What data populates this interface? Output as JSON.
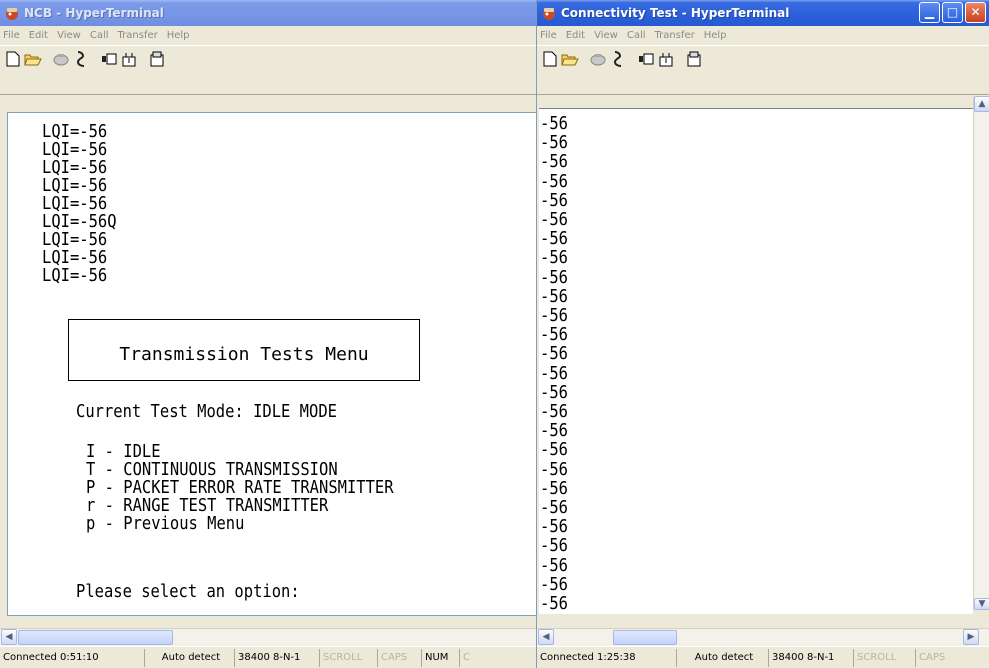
{
  "windows": {
    "left": {
      "title": "NCB - HyperTerminal",
      "menu": [
        "File",
        "Edit",
        "View",
        "Call",
        "Transfer",
        "Help"
      ],
      "terminal": {
        "lqi_lines": [
          "LQI=-56",
          "LQI=-56",
          "LQI=-56",
          "LQI=-56",
          "LQI=-56",
          "LQI=-56Q",
          "LQI=-56",
          "LQI=-56",
          "LQI=-56"
        ],
        "menu_title": "Transmission Tests Menu",
        "current_mode": "Current Test Mode: IDLE MODE",
        "options": [
          "I - IDLE",
          "T - CONTINUOUS TRANSMISSION",
          "P - PACKET ERROR RATE TRANSMITTER",
          "r - RANGE TEST TRANSMITTER",
          "p - Previous Menu"
        ],
        "prompt": "Please select an option:"
      },
      "status": {
        "connected": "Connected 0:51:10",
        "detect": "Auto detect",
        "settings": "38400 8-N-1",
        "scroll": "SCROLL",
        "caps": "CAPS",
        "num": "NUM",
        "extra": "C"
      }
    },
    "right": {
      "title": "Connectivity Test - HyperTerminal",
      "menu": [
        "File",
        "Edit",
        "View",
        "Call",
        "Transfer",
        "Help"
      ],
      "terminal": {
        "lines": [
          "-56",
          "-56",
          "-56",
          "-56",
          "-56",
          "-56",
          "-56",
          "-56",
          "-56",
          "-56",
          "-56",
          "-56",
          "-56",
          "-56",
          "-56",
          "-56",
          "-56",
          "-56",
          "-56",
          "-56",
          "-56",
          "-56",
          "-56",
          "-56",
          "-56",
          "-56"
        ]
      },
      "status": {
        "connected": "Connected 1:25:38",
        "detect": "Auto detect",
        "settings": "38400 8-N-1",
        "scroll": "SCROLL",
        "caps": "CAPS"
      }
    }
  },
  "icons": {
    "app": "hyperterminal-icon",
    "toolbar": [
      "new-icon",
      "open-icon",
      "disconnect-icon",
      "connect-icon",
      "send-icon",
      "receive-icon",
      "properties-icon"
    ]
  },
  "colors": {
    "titlebar_active": "#2a5fd9",
    "titlebar_inactive": "#7a9ae8",
    "close_button": "#c8401f"
  }
}
